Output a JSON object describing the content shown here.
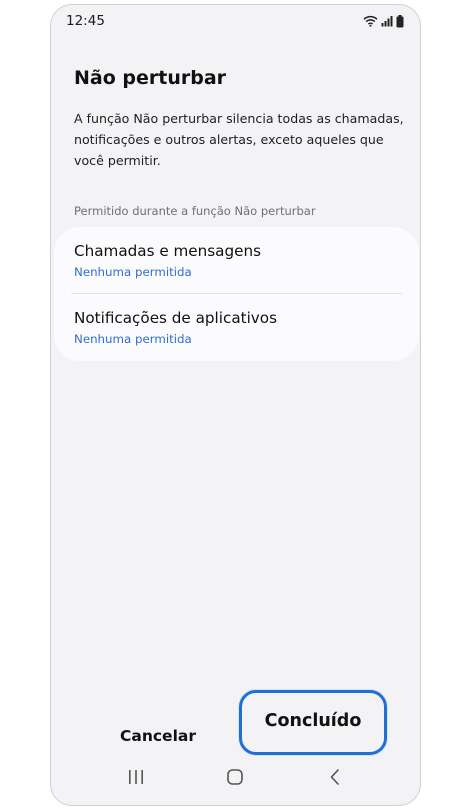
{
  "status_bar": {
    "time": "12:45",
    "icons": [
      "wifi-icon",
      "signal-icon",
      "battery-icon"
    ]
  },
  "screen": {
    "title": "Não perturbar",
    "description": "A função Não perturbar silencia todas as chamadas, notificações e outros alertas, exceto aqueles que você permitir.",
    "section_header": "Permitido durante a função Não perturbar",
    "items": [
      {
        "title": "Chamadas e mensagens",
        "subtitle": "Nenhuma permitida"
      },
      {
        "title": "Notificações de aplicativos",
        "subtitle": "Nenhuma permitida"
      }
    ]
  },
  "actions": {
    "cancel_label": "Cancelar",
    "done_label": "Concluído"
  },
  "nav_bar": {
    "buttons": [
      "recent-apps-icon",
      "home-icon",
      "back-icon"
    ]
  },
  "colors": {
    "accent_link": "#2f6fcf",
    "highlight_border": "#1f6fd6",
    "background": "#f3f3f6"
  }
}
